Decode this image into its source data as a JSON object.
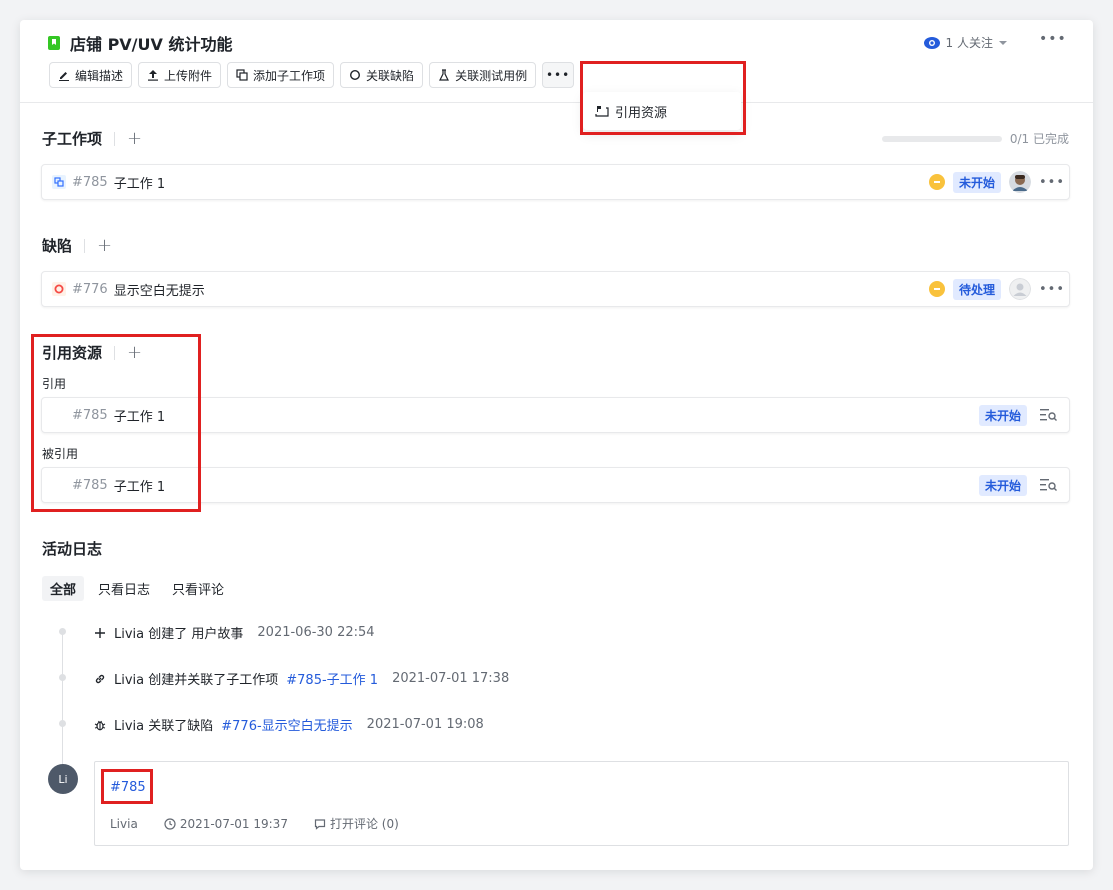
{
  "header": {
    "title": "店铺 PV/UV 统计功能",
    "followers": "1 人关注",
    "more": "•••"
  },
  "toolbar": {
    "edit_desc": "编辑描述",
    "upload": "上传附件",
    "add_subitem": "添加子工作项",
    "link_bug": "关联缺陷",
    "link_testcase": "关联测试用例",
    "more": "•••"
  },
  "dropdown": {
    "item": "引用资源"
  },
  "subitems": {
    "title": "子工作项",
    "plus": "+",
    "progress_text": "0/1 已完成",
    "progress_fraction": 0,
    "items": [
      {
        "id": "#785",
        "name": "子工作 1",
        "status": "未开始"
      }
    ]
  },
  "bugs": {
    "title": "缺陷",
    "plus": "+",
    "items": [
      {
        "id": "#776",
        "name": "显示空白无提示",
        "status": "待处理"
      }
    ]
  },
  "refs": {
    "title": "引用资源",
    "plus": "+",
    "ref_label": "引用",
    "ref_item": {
      "id": "#785",
      "name": "子工作 1",
      "status": "未开始"
    },
    "refby_label": "被引用",
    "refby_item": {
      "id": "#785",
      "name": "子工作 1",
      "status": "未开始"
    }
  },
  "activity": {
    "title": "活动日志",
    "tabs": [
      "全部",
      "只看日志",
      "只看评论"
    ],
    "logs": [
      {
        "text": "Livia 创建了 用户故事",
        "link": "",
        "time": "2021-06-30 22:54"
      },
      {
        "text": "Livia 创建并关联了子工作项",
        "link": "#785-子工作 1",
        "time": "2021-07-01 17:38"
      },
      {
        "text": "Livia 关联了缺陷",
        "link": "#776-显示空白无提示",
        "time": "2021-07-01 19:08"
      }
    ],
    "comment": {
      "avatar": "Li",
      "link": "#785",
      "author": "Livia",
      "time": "2021-07-01 19:37",
      "open_comments": "打开评论 (0)"
    }
  },
  "colors": {
    "accent": "#3370ff",
    "link": "#245bdb",
    "highlight": "#e02020",
    "badge_bg": "#e1eaff"
  }
}
